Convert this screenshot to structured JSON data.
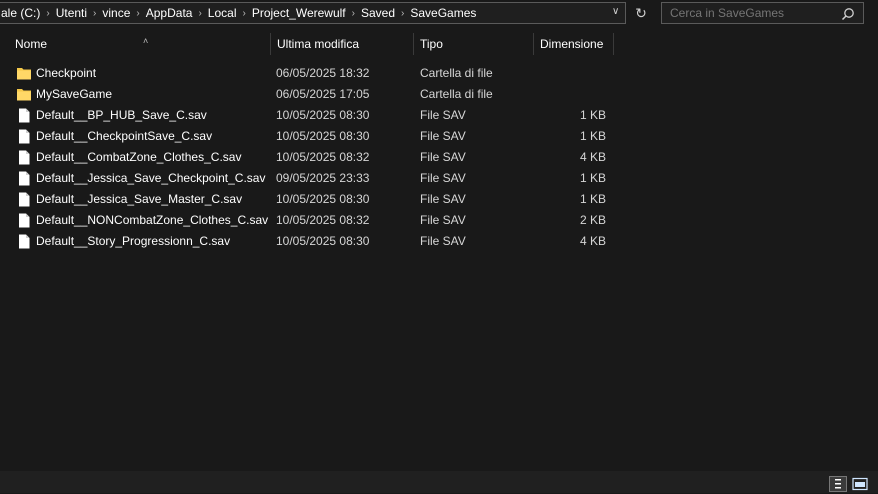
{
  "breadcrumb": {
    "items": [
      "ale (C:)",
      "Utenti",
      "vince",
      "AppData",
      "Local",
      "Project_Werewulf",
      "Saved",
      "SaveGames"
    ]
  },
  "search": {
    "placeholder": "Cerca in SaveGames"
  },
  "columns": {
    "name": "Nome",
    "modified": "Ultima modifica",
    "type": "Tipo",
    "size": "Dimensione"
  },
  "files": [
    {
      "name": "Checkpoint",
      "modified": "06/05/2025 18:32",
      "type": "Cartella di file",
      "size": "",
      "icon": "folder-icon"
    },
    {
      "name": "MySaveGame",
      "modified": "06/05/2025 17:05",
      "type": "Cartella di file",
      "size": "",
      "icon": "folder-icon"
    },
    {
      "name": "Default__BP_HUB_Save_C.sav",
      "modified": "10/05/2025 08:30",
      "type": "File SAV",
      "size": "1 KB",
      "icon": "file-icon"
    },
    {
      "name": "Default__CheckpointSave_C.sav",
      "modified": "10/05/2025 08:30",
      "type": "File SAV",
      "size": "1 KB",
      "icon": "file-icon"
    },
    {
      "name": "Default__CombatZone_Clothes_C.sav",
      "modified": "10/05/2025 08:32",
      "type": "File SAV",
      "size": "4 KB",
      "icon": "file-icon"
    },
    {
      "name": "Default__Jessica_Save_Checkpoint_C.sav",
      "modified": "09/05/2025 23:33",
      "type": "File SAV",
      "size": "1 KB",
      "icon": "file-icon"
    },
    {
      "name": "Default__Jessica_Save_Master_C.sav",
      "modified": "10/05/2025 08:30",
      "type": "File SAV",
      "size": "1 KB",
      "icon": "file-icon"
    },
    {
      "name": "Default__NONCombatZone_Clothes_C.sav",
      "modified": "10/05/2025 08:32",
      "type": "File SAV",
      "size": "2 KB",
      "icon": "file-icon"
    },
    {
      "name": "Default__Story_Progressionn_C.sav",
      "modified": "10/05/2025 08:30",
      "type": "File SAV",
      "size": "4 KB",
      "icon": "file-icon"
    }
  ],
  "colors": {
    "background": "#191919",
    "folder": "#f4c84a",
    "text": "#ffffff"
  }
}
